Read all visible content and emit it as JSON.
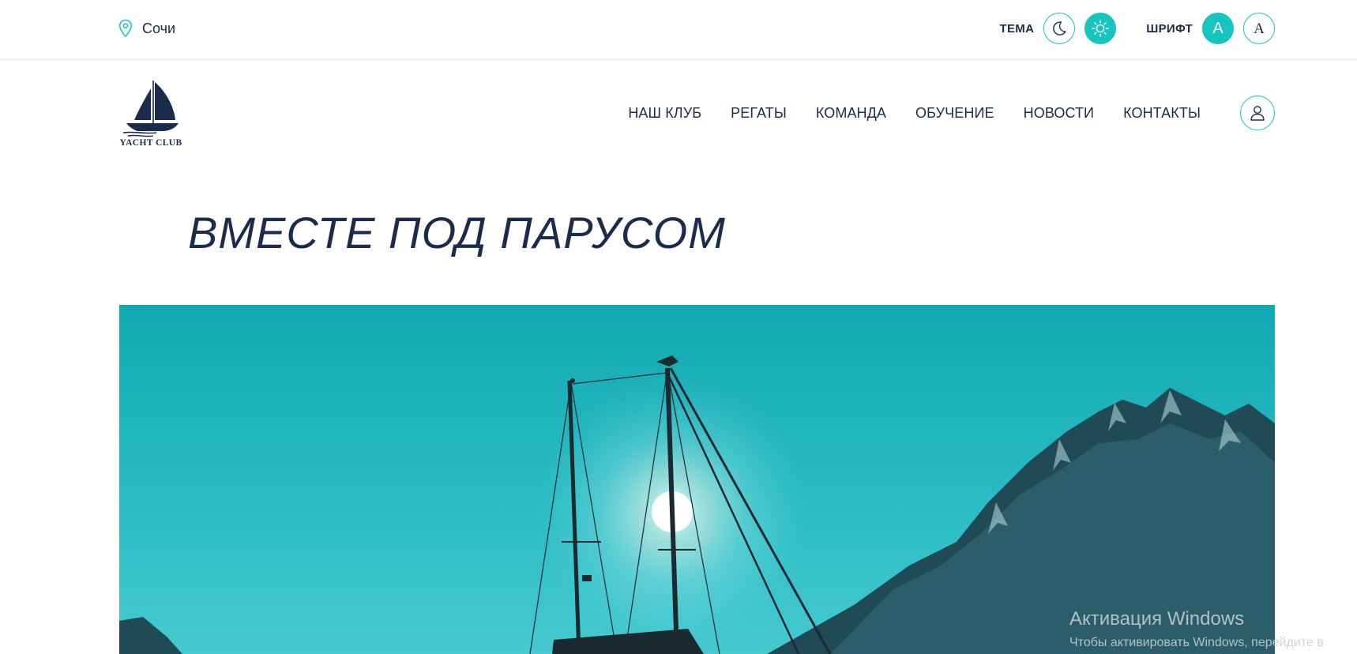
{
  "topbar": {
    "city": "Сочи",
    "theme_label": "ТЕМА",
    "font_label": "ШРИФТ",
    "font_option_sans": "A",
    "font_option_serif": "A"
  },
  "logo": {
    "text": "YACHT CLUB"
  },
  "nav": {
    "items": [
      "НАШ КЛУБ",
      "РЕГАТЫ",
      "КОМАНДА",
      "ОБУЧЕНИЕ",
      "НОВОСТИ",
      "КОНТАКТЫ"
    ]
  },
  "hero": {
    "title": "ВМЕСТЕ ПОД ПАРУСОМ"
  },
  "watermark": {
    "title": "Активация Windows",
    "subtitle": "Чтобы активировать Windows, перейдите в"
  },
  "colors": {
    "accent": "#17c5c0",
    "text": "#1b2b4b",
    "sky": "#1fb6bd"
  },
  "icons": {
    "location": "map-pin-icon",
    "dark_theme": "moon-icon",
    "light_theme": "sun-icon",
    "user": "user-icon"
  }
}
